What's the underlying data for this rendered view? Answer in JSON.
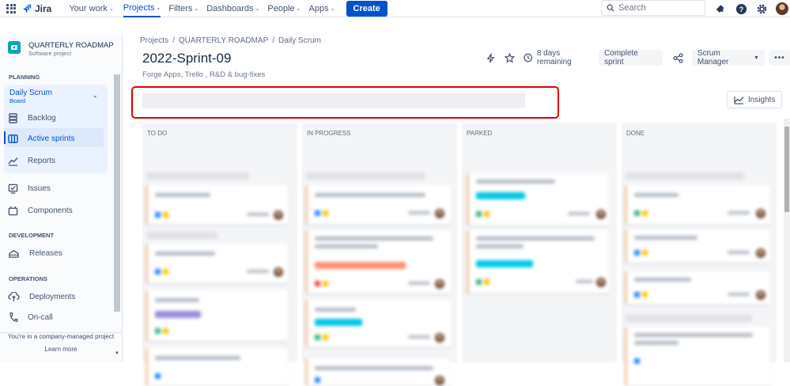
{
  "topnav": {
    "brand": "Jira",
    "items": [
      {
        "label": "Your work",
        "active": false
      },
      {
        "label": "Projects",
        "active": true
      },
      {
        "label": "Filters",
        "active": false
      },
      {
        "label": "Dashboards",
        "active": false
      },
      {
        "label": "People",
        "active": false
      },
      {
        "label": "Apps",
        "active": false
      }
    ],
    "create_label": "Create",
    "search_placeholder": "Search",
    "icons": [
      "notifications-icon",
      "help-icon",
      "settings-icon",
      "profile-avatar"
    ]
  },
  "sidebar": {
    "project_name": "QUARTERLY ROADMAP",
    "project_type": "Software project",
    "planning_label": "PLANNING",
    "board_title": "Daily Scrum",
    "board_sub": "Board",
    "planning_items": [
      {
        "label": "Backlog",
        "icon": "backlog-icon"
      },
      {
        "label": "Active sprints",
        "icon": "active-sprints-icon",
        "active": true
      },
      {
        "label": "Reports",
        "icon": "reports-icon"
      }
    ],
    "other_items": [
      {
        "label": "Issues",
        "icon": "issues-icon"
      },
      {
        "label": "Components",
        "icon": "components-icon"
      }
    ],
    "development_label": "DEVELOPMENT",
    "development_items": [
      {
        "label": "Releases",
        "icon": "releases-icon"
      }
    ],
    "operations_label": "OPERATIONS",
    "operations_items": [
      {
        "label": "Deployments",
        "icon": "deployments-icon"
      },
      {
        "label": "On-call",
        "icon": "on-call-icon"
      }
    ],
    "footer_text": "You're in a company-managed project",
    "footer_link": "Learn more"
  },
  "main": {
    "breadcrumb": [
      "Projects",
      "QUARTERLY ROADMAP",
      "Daily Scrum"
    ],
    "title": "2022-Sprint-09",
    "subtitle": "Forge Apps, Trello , R&D & bug-fixes",
    "remaining": "8 days remaining",
    "complete_sprint_label": "Complete sprint",
    "scrum_manager_label": "Scrum Manager",
    "insights_label": "Insights"
  },
  "board": {
    "columns": [
      "TO DO",
      "IN PROGRESS",
      "PARKED",
      "DONE"
    ]
  },
  "colors": {
    "brand": "#0052cc",
    "highlight": "#e00000",
    "tag_teal": "#00c7e6",
    "tag_purple": "#998dd9",
    "tag_red": "#ff8f73"
  }
}
